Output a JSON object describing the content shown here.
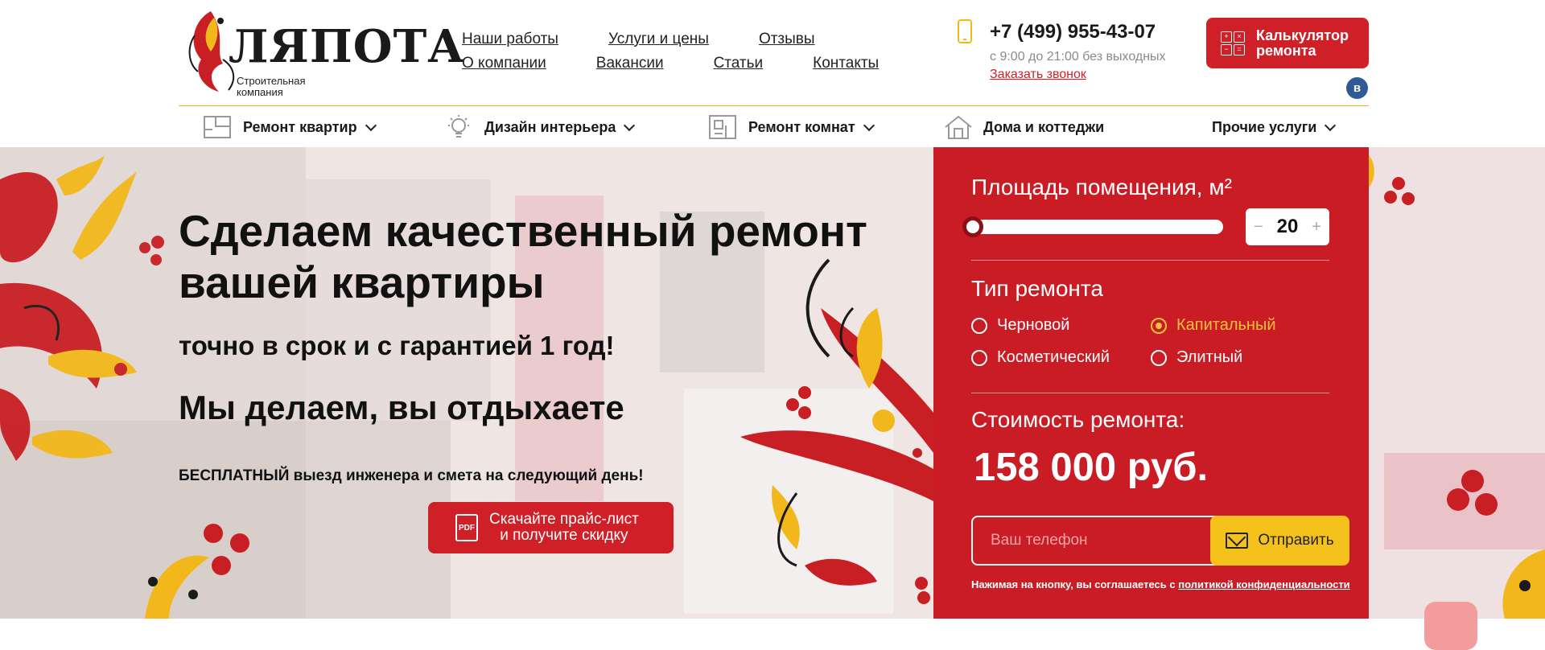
{
  "brand": {
    "name": "ЛЯПОТА",
    "subtitle_1": "Строительная",
    "subtitle_2": "компания"
  },
  "top_nav": {
    "row1": [
      "Наши работы",
      "Услуги и цены",
      "Отзывы"
    ],
    "row2": [
      "О компании",
      "Вакансии",
      "Статьи",
      "Контакты"
    ]
  },
  "contacts": {
    "phone": "+7 (499) 955-43-07",
    "hours": "с 9:00 до 21:00 без выходных",
    "callback": "Заказать звонок"
  },
  "calc_button": {
    "line1": "Калькулятор",
    "line2": "ремонта"
  },
  "social": {
    "vk": "в"
  },
  "main_nav": [
    {
      "label": "Ремонт квартир",
      "icon": "floorplan-icon",
      "has_dropdown": true
    },
    {
      "label": "Дизайн интерьера",
      "icon": "lightbulb-icon",
      "has_dropdown": true
    },
    {
      "label": "Ремонт комнат",
      "icon": "room-icon",
      "has_dropdown": true
    },
    {
      "label": "Дома и коттеджи",
      "icon": "house-icon",
      "has_dropdown": false
    },
    {
      "label": "Прочие услуги",
      "icon": "",
      "has_dropdown": true
    }
  ],
  "hero": {
    "title_line1": "Сделаем качественный ремонт",
    "title_line2": "вашей квартиры",
    "subtitle": "точно в срок и с гарантией 1 год!",
    "slogan": "Мы делаем, вы отдыхаете",
    "offer_bold": "БЕСПЛАТНЫЙ",
    "offer_rest": " выезд инженера и смета на следующий день!",
    "pdf_icon_text": "PDF",
    "pdf_button_line1": "Скачайте прайс-лист",
    "pdf_button_line2": "и получите скидку"
  },
  "calculator": {
    "area_label": "Площадь помещения, м²",
    "area_value": "20",
    "area_slider_fraction": 0.0,
    "minus": "−",
    "plus": "+",
    "type_label": "Тип ремонта",
    "types": [
      {
        "label": "Черновой",
        "selected": false
      },
      {
        "label": "Капитальный",
        "selected": true
      },
      {
        "label": "Косметический",
        "selected": false
      },
      {
        "label": "Элитный",
        "selected": false
      }
    ],
    "cost_label": "Стоимость ремонта:",
    "cost_value": "158 000 руб.",
    "phone_placeholder": "Ваш телефон",
    "send_label": "Отправить",
    "consent_text": "Нажимая на кнопку, вы соглашаетесь с ",
    "consent_link": "политикой конфиденциальности"
  },
  "colors": {
    "brand_red": "#cf1f27",
    "accent_yellow": "#f5c21c",
    "vk_blue": "#2f5a96"
  }
}
